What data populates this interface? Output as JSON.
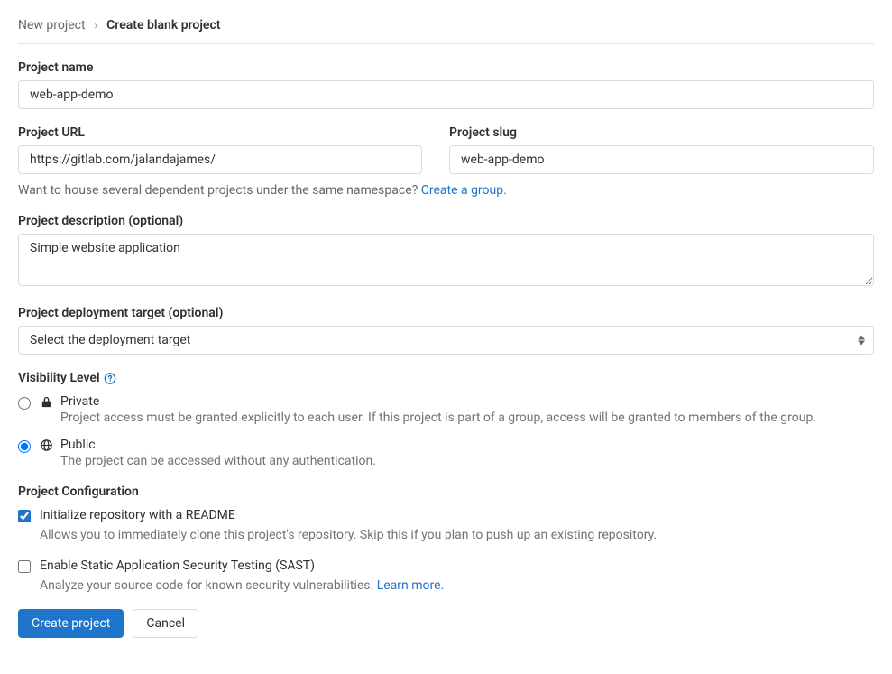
{
  "breadcrumb": {
    "parent": "New project",
    "current": "Create blank project"
  },
  "name": {
    "label": "Project name",
    "value": "web-app-demo"
  },
  "url": {
    "label": "Project URL",
    "value": "https://gitlab.com/jalandajames/"
  },
  "slug": {
    "label": "Project slug",
    "value": "web-app-demo"
  },
  "group_helper": {
    "text": "Want to house several dependent projects under the same namespace? ",
    "link": "Create a group."
  },
  "description": {
    "label": "Project description (optional)",
    "value": "Simple website application"
  },
  "deployment": {
    "label": "Project deployment target (optional)",
    "placeholder": "Select the deployment target"
  },
  "visibility": {
    "label": "Visibility Level",
    "options": [
      {
        "id": "private",
        "title": "Private",
        "desc": "Project access must be granted explicitly to each user. If this project is part of a group, access will be granted to members of the group.",
        "selected": false
      },
      {
        "id": "public",
        "title": "Public",
        "desc": "The project can be accessed without any authentication.",
        "selected": true
      }
    ]
  },
  "config": {
    "label": "Project Configuration",
    "readme": {
      "title": "Initialize repository with a README",
      "desc": "Allows you to immediately clone this project's repository. Skip this if you plan to push up an existing repository.",
      "checked": true
    },
    "sast": {
      "title": "Enable Static Application Security Testing (SAST)",
      "desc": "Analyze your source code for known security vulnerabilities. ",
      "link": "Learn more.",
      "checked": false
    }
  },
  "buttons": {
    "submit": "Create project",
    "cancel": "Cancel"
  }
}
